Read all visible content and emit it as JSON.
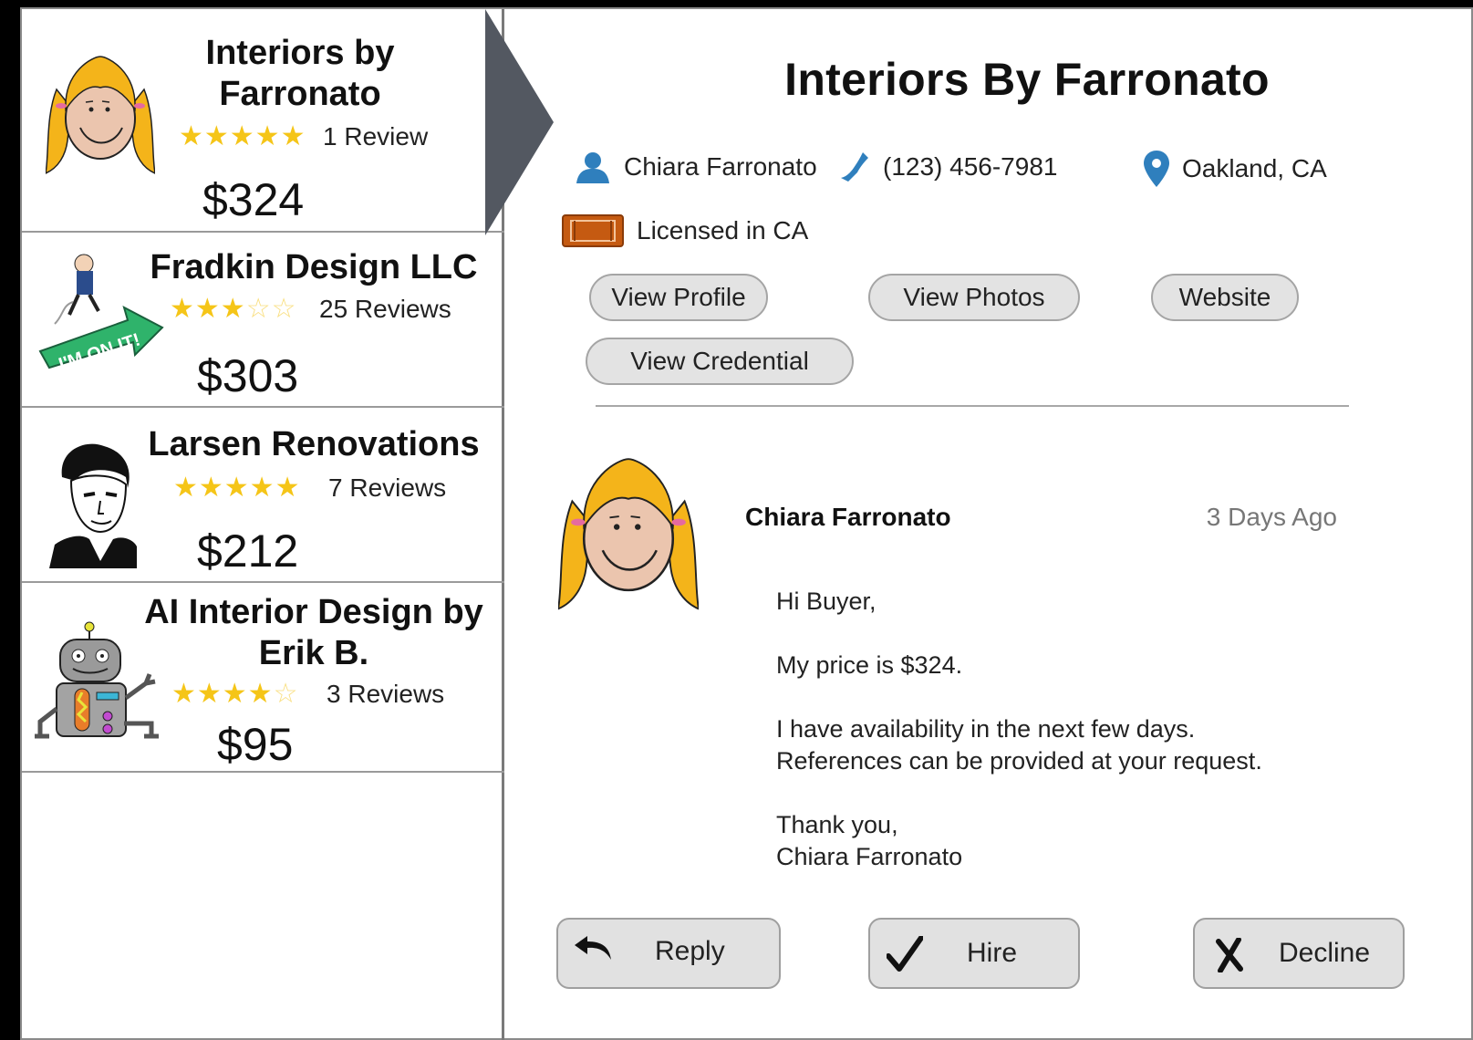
{
  "list": {
    "items": [
      {
        "name": "Interiors by Farronato",
        "rating": 5,
        "reviews": "1 Review",
        "price": "$324",
        "avatar": "girl-avatar-icon"
      },
      {
        "name": "Fradkin Design LLC",
        "rating": 3,
        "reviews": "25 Reviews",
        "price": "$303",
        "avatar": "im-on-it-avatar-icon"
      },
      {
        "name": "Larsen Renovations",
        "rating": 5,
        "reviews": "7 Reviews",
        "price": "$212",
        "avatar": "man-portrait-avatar-icon"
      },
      {
        "name": "AI Interior Design by Erik B.",
        "rating": 4,
        "reviews": "3 Reviews",
        "price": "$95",
        "avatar": "robot-avatar-icon"
      }
    ]
  },
  "detail": {
    "title": "Interiors By Farronato",
    "contact_name": "Chiara Farronato",
    "phone": "(123) 456-7981",
    "location": "Oakland, CA",
    "license": "Licensed in CA",
    "buttons": {
      "view_profile": "View Profile",
      "view_photos": "View Photos",
      "website": "Website",
      "view_credential": "View Credential"
    },
    "message": {
      "sender": "Chiara Farronato",
      "time": "3 Days Ago",
      "lines": [
        "Hi Buyer,",
        "My price is $324.",
        "I have availability in the next few days.",
        "References can be provided at your request.",
        "Thank you,",
        "Chiara Farronato"
      ]
    },
    "actions": {
      "reply": "Reply",
      "hire": "Hire",
      "decline": "Decline"
    }
  },
  "colors": {
    "star": "#f5c518",
    "pointer": "#535861",
    "icon_blue": "#2f7fbd",
    "license_orange": "#c55a11"
  }
}
